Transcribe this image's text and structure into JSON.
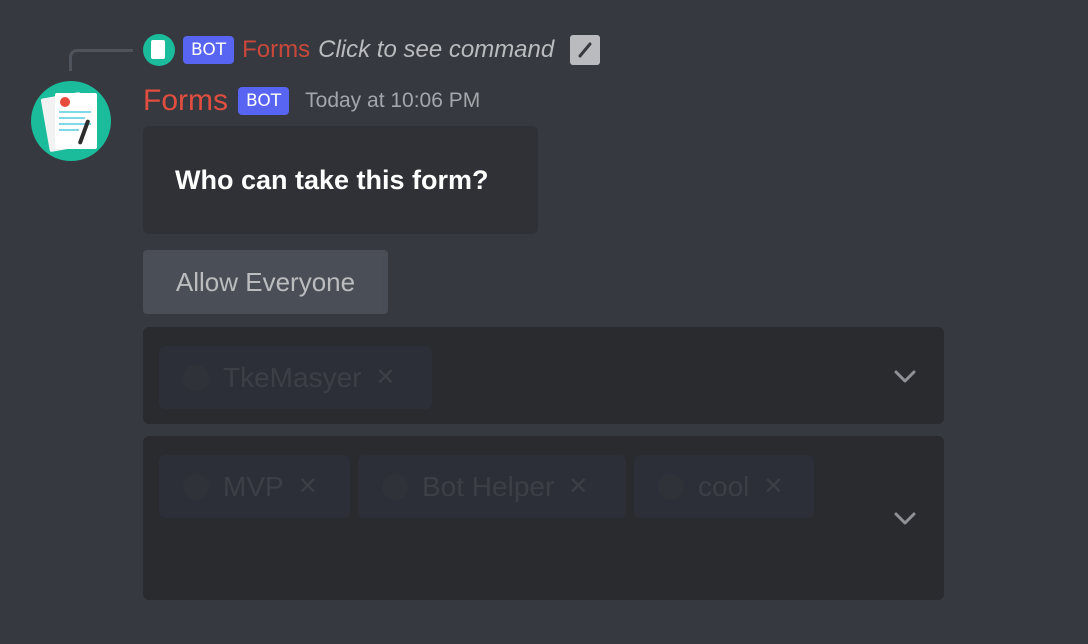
{
  "reply": {
    "bot_tag": "BOT",
    "author": "Forms",
    "command_text": "Click to see command",
    "icon": "slash-command-icon"
  },
  "message": {
    "author": "Forms",
    "bot_tag": "BOT",
    "timestamp": "Today at 10:06 PM",
    "avatar_icon": "forms-document-avatar"
  },
  "embed": {
    "title": "Who can take this form?"
  },
  "button": {
    "label": "Allow Everyone"
  },
  "user_select": {
    "chips": [
      {
        "label": "TkeMasyer",
        "remove": "✕"
      }
    ],
    "icon": "chevron-down-icon"
  },
  "role_select": {
    "chips": [
      {
        "label": "MVP",
        "remove": "✕"
      },
      {
        "label": "Bot Helper",
        "remove": "✕"
      },
      {
        "label": "cool",
        "remove": "✕"
      }
    ],
    "icon": "chevron-down-icon"
  },
  "colors": {
    "background": "#36393f",
    "bot_tag": "#5865f2",
    "author": "#e04e3f",
    "avatar": "#1abc9c"
  }
}
